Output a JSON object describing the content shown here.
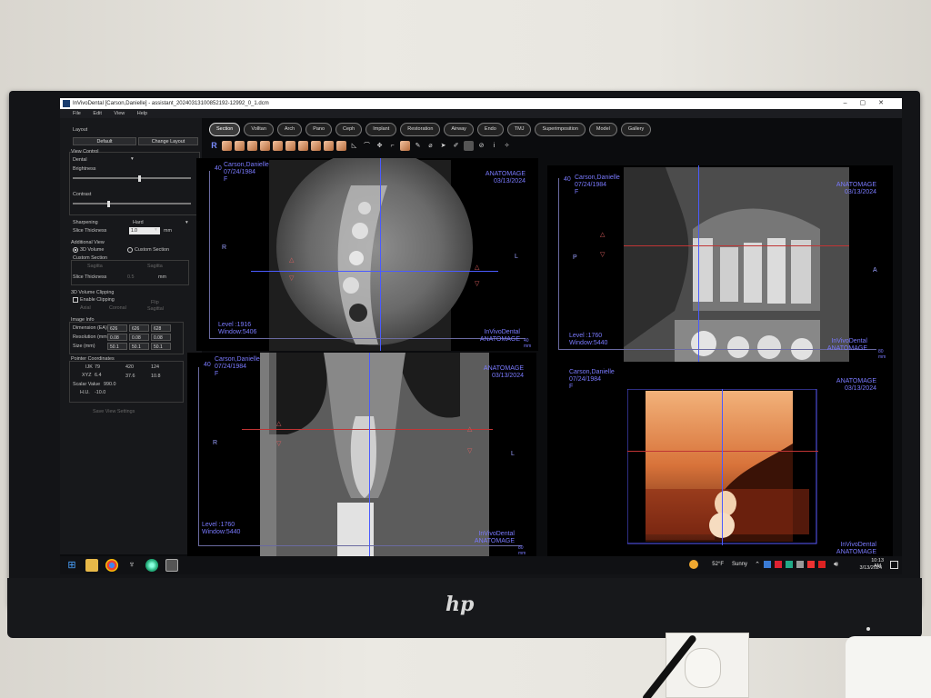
{
  "window": {
    "title": "InVivoDental [Carson,Danielle] - assistant_20240313100852192-12992_0_1.dcm",
    "menu": [
      "File",
      "Edit",
      "View",
      "Help"
    ]
  },
  "tabs": [
    "Section",
    "Volltan",
    "Arch",
    "Pano",
    "Ceph",
    "Implant",
    "Restoration",
    "Airway",
    "Endo",
    "TMJ",
    "Superimposition",
    "Model",
    "Gallery"
  ],
  "active_tab": "Section",
  "toolbar": {
    "r_label": "R",
    "info_label": "i"
  },
  "panel": {
    "layout_label": "Layout",
    "default_btn": "Default",
    "change_layout_btn": "Change Layout",
    "view_control_label": "View Control",
    "view_control_value": "Dental",
    "brightness_label": "Brightness",
    "contrast_label": "Contrast",
    "sharpening_label": "Sharpening",
    "sharpening_value": "Hard",
    "slice_thickness_label": "Slice Thickness",
    "slice_thickness_value": "1.0",
    "unit_mm": "mm",
    "additional_view_label": "Additional View",
    "volume_3d_label": "3D Volume",
    "custom_section_radio_label": "Custom Section",
    "custom_section_label": "Custom Section",
    "custom_left": "Sagitta",
    "custom_right": "Sagitta",
    "slice_thickness2_label": "Slice Thickness",
    "slice_thickness2_value": "0.5",
    "clipping_label": "3D Volume Clipping",
    "enable_clipping_label": "Enable Clipping",
    "flip_label": "Flip",
    "clip_axial": "Axial",
    "clip_coronal": "Coronal",
    "clip_sagittal": "Sagittal",
    "image_info_label": "Image Info",
    "dimension_label": "Dimension (EA)",
    "dimension": [
      "626",
      "626",
      "628"
    ],
    "resolution_label": "Resolution (mm)",
    "resolution": [
      "0.08",
      "0.08",
      "0.08"
    ],
    "size_label": "Size (mm)",
    "size": [
      "50.1",
      "50.1",
      "50.1"
    ],
    "pointer_label": "Pointer Coordinates",
    "ijk_label": "IJK",
    "ijk": [
      "79",
      "420",
      "124"
    ],
    "xyz_label": "XYZ",
    "xyz": [
      "6.4",
      "37.6",
      "10.8"
    ],
    "scalar_label": "Scalar Value",
    "scalar_value": "990.0",
    "hu_label": "H.U.",
    "hu_value": "-10.0",
    "save_view_btn": "Save View Settings"
  },
  "views": {
    "axial": {
      "patient": "Carson,Danielle",
      "dob": "07/24/1984",
      "flag": "F",
      "brand": "ANATOMAGE",
      "date": "03/13/2024",
      "level": "Level   :1916",
      "window": "Window:5406",
      "footer": "InVivoDental",
      "footer2": "ANATOMAGE",
      "left": "R",
      "right": "L",
      "scale_top": "40",
      "scale_unit": "mm",
      "scale_right": "40"
    },
    "sagittal": {
      "patient": "Carson,Danielle",
      "dob": "07/24/1984",
      "flag": "F",
      "brand": "ANATOMAGE",
      "date": "03/13/2024",
      "level": "Level   :1760",
      "window": "Window:5440",
      "footer": "InVivoDental",
      "footer2": "ANATOMAGE",
      "left": "P",
      "right": "A",
      "scale_top": "40",
      "scale_unit": "mm",
      "scale_right": "80"
    },
    "coronal": {
      "patient": "Carson,Danielle",
      "dob": "07/24/1984",
      "flag": "F",
      "brand": "ANATOMAGE",
      "date": "03/13/2024",
      "level": "Level   :1760",
      "window": "Window:5440",
      "footer": "InVivoDental",
      "footer2": "ANATOMAGE",
      "left": "R",
      "right": "L",
      "scale_top": "40",
      "scale_unit": "mm",
      "scale_right": "80"
    },
    "volume": {
      "patient": "Carson,Danielle",
      "dob": "07/24/1984",
      "flag": "F",
      "brand": "ANATOMAGE",
      "date": "03/13/2024",
      "footer": "InVivoDental",
      "footer2": "ANATOMAGE"
    }
  },
  "taskbar": {
    "weather_temp": "52°F",
    "weather_text": "Sunny",
    "time": "10:13 AM",
    "date": "3/13/2024"
  },
  "monitor": {
    "brand": "hp"
  },
  "colors": {
    "overlay_text": "#7a7aff",
    "crosshair_blue": "#4a5bff",
    "crosshair_red": "#c03535"
  }
}
